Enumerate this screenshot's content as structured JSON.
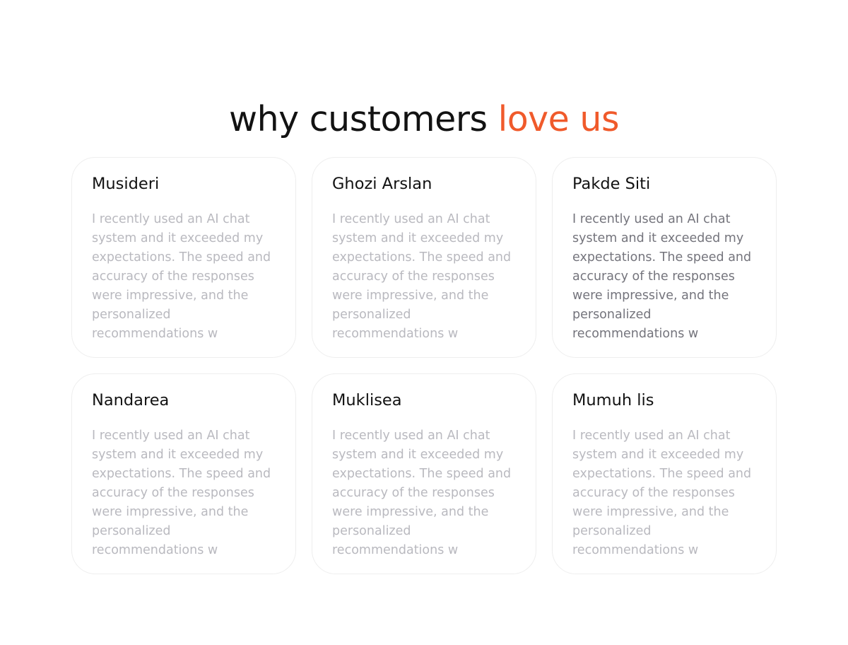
{
  "heading": {
    "prefix": "why customers",
    "accent": "love us"
  },
  "colors": {
    "accent": "#f05a2b",
    "title": "#121212",
    "text_muted": "#b9b9bf",
    "text_active": "#74747c",
    "card_border": "#eeeeee"
  },
  "testimonials": [
    {
      "name": "Musideri",
      "text": "I recently used an AI chat system and it exceeded my expectations. The speed and accuracy of the responses were impressive, and the personalized recommendations w",
      "featured": false
    },
    {
      "name": "Ghozi Arslan",
      "text": "I recently used an AI chat system and it exceeded my expectations. The speed and accuracy of the responses were impressive, and the personalized recommendations w",
      "featured": false
    },
    {
      "name": "Pakde Siti",
      "text": "I recently used an AI chat system and it exceeded my expectations. The speed and accuracy of the responses were impressive, and the personalized recommendations w",
      "featured": true
    },
    {
      "name": "Nandarea",
      "text": "I recently used an AI chat system and it exceeded my expectations. The speed and accuracy of the responses were impressive, and the personalized recommendations w",
      "featured": false
    },
    {
      "name": "Muklisea",
      "text": "I recently used an AI chat system and it exceeded my expectations. The speed and accuracy of the responses were impressive, and the personalized recommendations w",
      "featured": false
    },
    {
      "name": "Mumuh lis",
      "text": "I recently used an AI chat system and it exceeded my expectations. The speed and accuracy of the responses were impressive, and the personalized recommendations w",
      "featured": false
    }
  ]
}
